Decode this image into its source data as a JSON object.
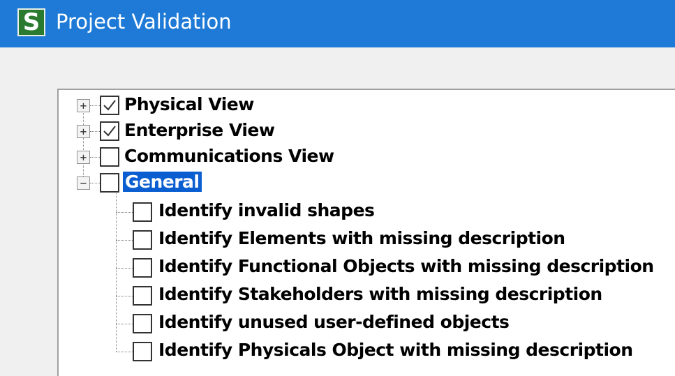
{
  "window": {
    "title": "Project Validation",
    "app_icon_letter": "S",
    "app_icon_color": "#2a7a2f",
    "titlebar_color": "#1e7ad6"
  },
  "tree": {
    "nodes": [
      {
        "label": "Physical View",
        "checked": true,
        "expander": "+"
      },
      {
        "label": "Enterprise View",
        "checked": true,
        "expander": "+"
      },
      {
        "label": "Communications View",
        "checked": false,
        "expander": "+"
      },
      {
        "label": "General",
        "checked": false,
        "expander": "−",
        "selected": true,
        "children": [
          {
            "label": "Identify invalid shapes",
            "checked": false
          },
          {
            "label": "Identify Elements with missing description",
            "checked": false
          },
          {
            "label": "Identify Functional Objects with missing description",
            "checked": false
          },
          {
            "label": "Identify Stakeholders with missing description",
            "checked": false
          },
          {
            "label": "Identify unused user-defined objects",
            "checked": false
          },
          {
            "label": "Identify Physicals Object with missing description",
            "checked": false
          }
        ]
      }
    ]
  }
}
